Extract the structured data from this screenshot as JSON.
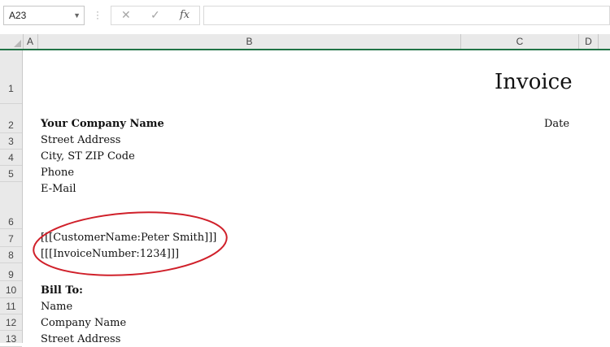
{
  "formula_bar": {
    "name_box": "A23",
    "formula": ""
  },
  "columns": [
    "A",
    "B",
    "C",
    "D"
  ],
  "rows": [
    "1",
    "2",
    "3",
    "4",
    "5",
    "6",
    "7",
    "8",
    "9",
    "10",
    "11",
    "12",
    "13"
  ],
  "sheet": {
    "title": "Invoice",
    "date_label": "Date",
    "company_name": "Your Company Name",
    "street": "Street Address",
    "city": "City, ST ZIP Code",
    "phone": "Phone",
    "email": "E-Mail",
    "customer_placeholder": "[[[CustomerName:Peter Smith]]]",
    "invoice_placeholder": "[[[InvoiceNumber:1234]]]",
    "bill_to": "Bill To:",
    "bill_name": "Name",
    "bill_company": "Company Name",
    "bill_street": "Street Address"
  },
  "colors": {
    "accent": "#217346",
    "highlight_oval": "#d0202a"
  }
}
